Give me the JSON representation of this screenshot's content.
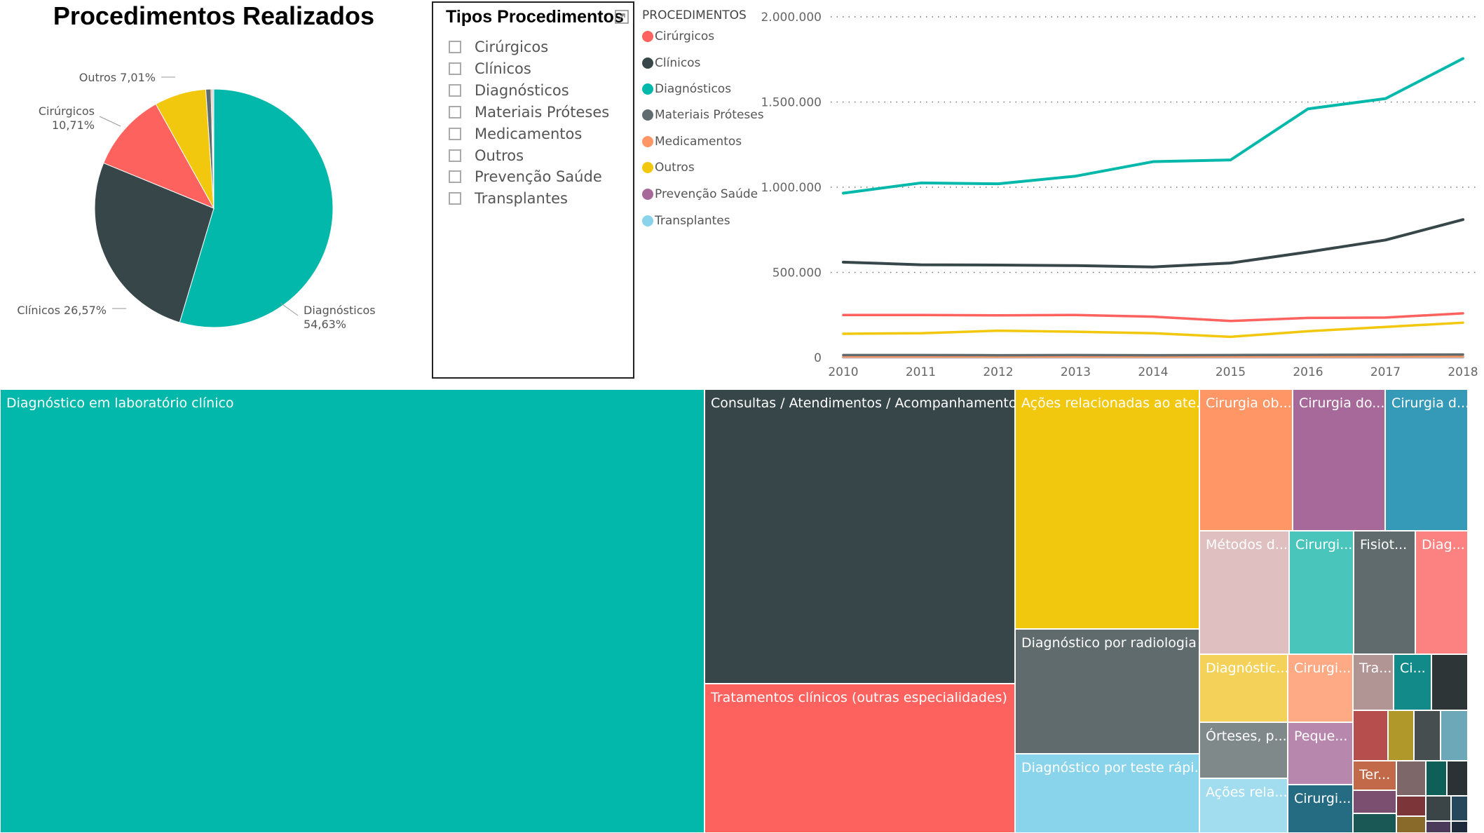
{
  "pie": {
    "title": "Procedimentos Realizados",
    "chart_data": {
      "type": "pie",
      "slices": [
        {
          "name": "Diagnósticos",
          "value": 54.63,
          "label_name": "Diagnósticos",
          "label_value": "54,63%",
          "color": "#01B8AA"
        },
        {
          "name": "Clínicos",
          "value": 26.57,
          "label_name": "Clínicos",
          "label_value": "26,57%",
          "color": "#374649"
        },
        {
          "name": "Cirúrgicos",
          "value": 10.71,
          "label_name": "Cirúrgicos",
          "label_value": "10,71%",
          "color": "#FD625E"
        },
        {
          "name": "Outros",
          "value": 7.01,
          "label_name": "Outros",
          "label_value": "7,01%",
          "color": "#F2C80F"
        },
        {
          "name": "Materiais Próteses",
          "value": 0.7,
          "color": "#5F6B6D"
        },
        {
          "name": "Medicamentos",
          "value": 0.2,
          "color": "#FE9666"
        },
        {
          "name": "Transplantes",
          "value": 0.18,
          "color": "#8AD4EB"
        }
      ]
    }
  },
  "slicer": {
    "title": "Tipos Procedimentos",
    "items": [
      "Cirúrgicos",
      "Clínicos",
      "Diagnósticos",
      "Materiais Próteses",
      "Medicamentos",
      "Outros",
      "Prevenção Saúde",
      "Transplantes"
    ]
  },
  "line": {
    "legend_title": "PROCEDIMENTOS",
    "chart_data": {
      "type": "line",
      "x": [
        "2010",
        "2011",
        "2012",
        "2013",
        "2014",
        "2015",
        "2016",
        "2017",
        "2018"
      ],
      "y_ticks": [
        "0",
        "500.000",
        "1.000.000",
        "1.500.000",
        "2.000.000"
      ],
      "ylim": [
        0,
        2000000
      ],
      "grid": true,
      "series": [
        {
          "name": "Cirúrgicos",
          "color": "#FD625E",
          "values": [
            250000,
            250000,
            248000,
            250000,
            240000,
            215000,
            233000,
            235000,
            260000
          ]
        },
        {
          "name": "Clínicos",
          "color": "#374649",
          "values": [
            560000,
            545000,
            543000,
            540000,
            532000,
            555000,
            620000,
            690000,
            810000
          ]
        },
        {
          "name": "Diagnósticos",
          "color": "#01B8AA",
          "values": [
            965000,
            1025000,
            1020000,
            1065000,
            1150000,
            1160000,
            1460000,
            1520000,
            1755000
          ]
        },
        {
          "name": "Materiais Próteses",
          "color": "#5F6B6D",
          "values": [
            15000,
            15000,
            14000,
            15000,
            14000,
            15000,
            16000,
            17000,
            18000
          ]
        },
        {
          "name": "Medicamentos",
          "color": "#FE9666",
          "values": [
            5000,
            5000,
            5000,
            5000,
            5000,
            5000,
            5000,
            5000,
            6000
          ]
        },
        {
          "name": "Outros",
          "color": "#F2C80F",
          "values": [
            140000,
            143000,
            158000,
            152000,
            143000,
            122000,
            155000,
            180000,
            205000
          ]
        },
        {
          "name": "Prevenção Saúde",
          "color": "#A66999",
          "values": [
            2000,
            2000,
            2000,
            2000,
            2000,
            2000,
            2000,
            2000,
            2000
          ]
        },
        {
          "name": "Transplantes",
          "color": "#8AD4EB",
          "values": [
            3000,
            3000,
            3000,
            3000,
            3000,
            3000,
            3000,
            3000,
            3000
          ]
        }
      ]
    }
  },
  "treemap": {
    "tiles": [
      {
        "label": "Diagnóstico em laboratório clínico",
        "color": "#01B8AA"
      },
      {
        "label": "Consultas / Atendimentos / Acompanhamentos",
        "color": "#374649"
      },
      {
        "label": "Tratamentos clínicos (outras especialidades)",
        "color": "#FD625E"
      },
      {
        "label": "Ações relacionadas ao ate...",
        "color": "#F2C80F"
      },
      {
        "label": "Diagnóstico por radiologia",
        "color": "#5F6B6D"
      },
      {
        "label": "Diagnóstico por teste rápi...",
        "color": "#8AD4EB"
      },
      {
        "label": "Cirurgia ob...",
        "color": "#FE9666"
      },
      {
        "label": "Cirurgia do...",
        "color": "#A66999"
      },
      {
        "label": "Cirurgia d...",
        "color": "#3599B8"
      },
      {
        "label": "Métodos d...",
        "color": "#DFBFBF"
      },
      {
        "label": "Cirurgi...",
        "color": "#4AC5BB"
      },
      {
        "label": "Fisiot...",
        "color": "#5F6B6D"
      },
      {
        "label": "Diag...",
        "color": "#FB8281"
      },
      {
        "label": "Diagnóstic...",
        "color": "#F4D25A"
      },
      {
        "label": "Cirurgi...",
        "color": "#FEAB85"
      },
      {
        "label": "Tra...",
        "color": "#B19594"
      },
      {
        "label": "Ci...",
        "color": "#138A8A"
      },
      {
        "label": "",
        "color": "#2D3537"
      },
      {
        "label": "Órteses, p...",
        "color": "#7F898A"
      },
      {
        "label": "Peque...",
        "color": "#B887AD"
      },
      {
        "label": "Ações rela...",
        "color": "#A1DDEF"
      },
      {
        "label": "Cirurgi...",
        "color": "#256C83"
      },
      {
        "label": "",
        "color": "#B54E4C"
      },
      {
        "label": "",
        "color": "#B1982A"
      },
      {
        "label": "",
        "color": "#474E50"
      },
      {
        "label": "",
        "color": "#6DA8B9"
      },
      {
        "label": "Ter...",
        "color": "#C2694A"
      },
      {
        "label": "",
        "color": "#7E6769"
      },
      {
        "label": "",
        "color": "#0E5F57"
      },
      {
        "label": "",
        "color": "#2A3236"
      },
      {
        "label": "",
        "color": "#7B4F6F"
      },
      {
        "label": "",
        "color": "#7C3538"
      },
      {
        "label": "",
        "color": "#3B4547"
      },
      {
        "label": "",
        "color": "#26485A"
      },
      {
        "label": "",
        "color": "#1A5856"
      },
      {
        "label": "",
        "color": "#8A6A2A"
      },
      {
        "label": "",
        "color": "#4C3A5A"
      },
      {
        "label": "",
        "color": "#1F2A3A"
      }
    ]
  }
}
